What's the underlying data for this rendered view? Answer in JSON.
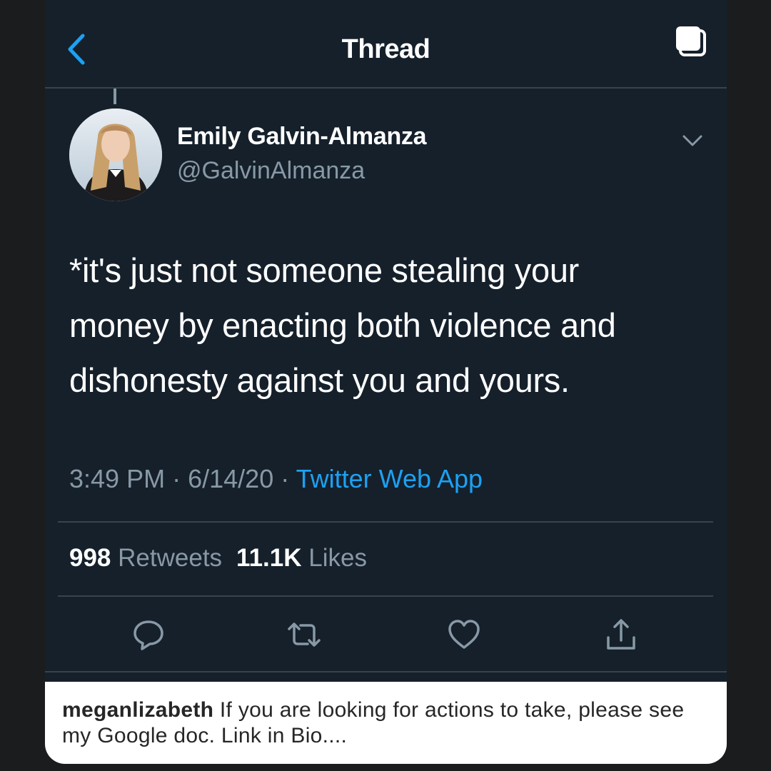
{
  "header": {
    "title": "Thread",
    "back_icon": "chevron-left-icon",
    "layers_icon": "layers-icon"
  },
  "tweet": {
    "author_name": "Emily Galvin-Almanza",
    "author_handle": "@GalvinAlmanza",
    "text_lines": [
      "*it's just not someone stealing your",
      "money by enacting both violence and",
      "dishonesty against you and yours."
    ],
    "time": "3:49 PM",
    "date": "6/14/20",
    "separator": "·",
    "source": "Twitter Web App",
    "retweet_count": "998",
    "retweets_label": "Retweets",
    "like_count": "11.1K",
    "likes_label": "Likes"
  },
  "actions": [
    {
      "name": "reply",
      "icon": "reply-icon"
    },
    {
      "name": "retweet",
      "icon": "retweet-icon"
    },
    {
      "name": "like",
      "icon": "heart-icon"
    },
    {
      "name": "share",
      "icon": "share-icon"
    }
  ],
  "caption": {
    "username": "meganlizabeth",
    "text": "If you are looking for actions to take, please see my Google doc. Link in Bio...."
  },
  "colors": {
    "background": "#15202b",
    "accent": "#1da1f2",
    "secondary_text": "#8899a6",
    "divider": "#38444d"
  }
}
